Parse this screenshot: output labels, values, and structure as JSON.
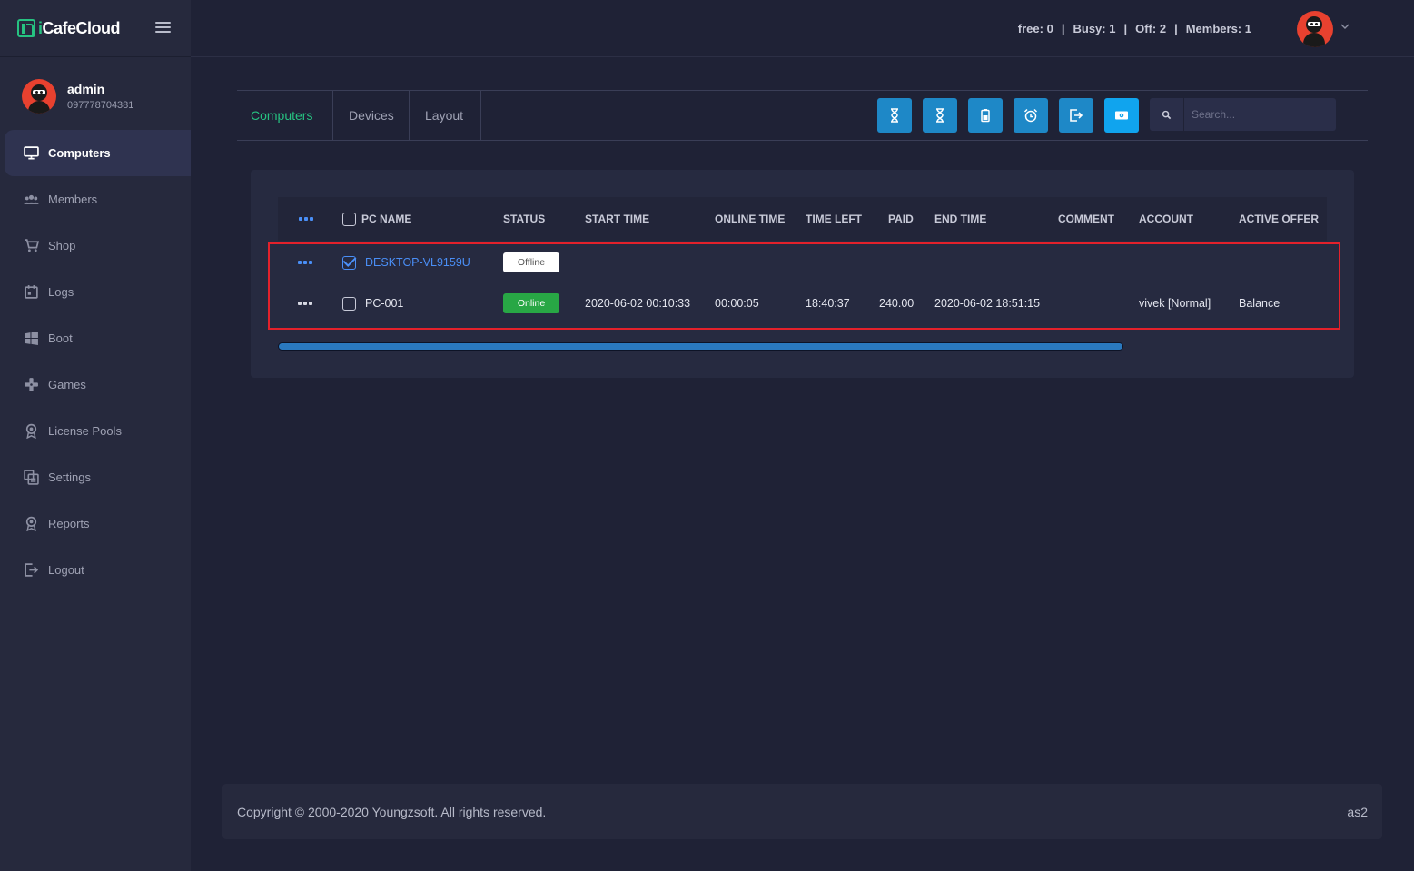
{
  "brand": {
    "name_prefix": "i",
    "name_rest": "CafeCloud"
  },
  "user": {
    "name": "admin",
    "phone": "097778704381"
  },
  "sidebar": {
    "items": [
      {
        "label": "Computers",
        "icon": "monitor-icon",
        "active": true
      },
      {
        "label": "Members",
        "icon": "users-icon"
      },
      {
        "label": "Shop",
        "icon": "cart-icon"
      },
      {
        "label": "Logs",
        "icon": "calendar-icon"
      },
      {
        "label": "Boot",
        "icon": "windows-icon"
      },
      {
        "label": "Games",
        "icon": "gamepad-icon"
      },
      {
        "label": "License Pools",
        "icon": "badge-icon"
      },
      {
        "label": "Settings",
        "icon": "settings-icon"
      },
      {
        "label": "Reports",
        "icon": "award-icon"
      },
      {
        "label": "Logout",
        "icon": "logout-icon"
      }
    ]
  },
  "header": {
    "stats": [
      {
        "label": "free:",
        "value": "0"
      },
      {
        "label": "Busy:",
        "value": "1"
      },
      {
        "label": "Off:",
        "value": "2"
      },
      {
        "label": "Members:",
        "value": "1"
      }
    ],
    "separator": "|"
  },
  "tabs": [
    {
      "label": "Computers",
      "active": true
    },
    {
      "label": "Devices"
    },
    {
      "label": "Layout"
    }
  ],
  "toolbar_buttons": [
    "hourglass-icon",
    "hourglass-icon",
    "battery-icon",
    "alarm-icon",
    "exit-icon",
    "money-icon"
  ],
  "search": {
    "placeholder": "Search..."
  },
  "table": {
    "columns": [
      "PC NAME",
      "STATUS",
      "START TIME",
      "ONLINE TIME",
      "TIME LEFT",
      "PAID",
      "END TIME",
      "COMMENT",
      "ACCOUNT",
      "ACTIVE OFFER"
    ],
    "rows": [
      {
        "pc_name": "DESKTOP-VL9159U",
        "checked": true,
        "status": "Offline",
        "start_time": "",
        "online_time": "",
        "time_left": "",
        "paid": "",
        "end_time": "",
        "comment": "",
        "account": "",
        "active_offer": ""
      },
      {
        "pc_name": "PC-001",
        "checked": false,
        "status": "Online",
        "start_time": "2020-06-02 00:10:33",
        "online_time": "00:00:05",
        "time_left": "18:40:37",
        "paid": "240.00",
        "end_time": "2020-06-02 18:51:15",
        "comment": "",
        "account": "vivek [Normal]",
        "active_offer": "Balance"
      }
    ]
  },
  "footer": {
    "copyright": "Copyright © 2000-2020 Youngzsoft. All rights reserved.",
    "server": "as2"
  },
  "colors": {
    "accent_green": "#26c281",
    "button_blue": "#1e88c7",
    "link_blue": "#4a8ff7",
    "online_green": "#28a745",
    "highlight_red": "#e3212b"
  }
}
